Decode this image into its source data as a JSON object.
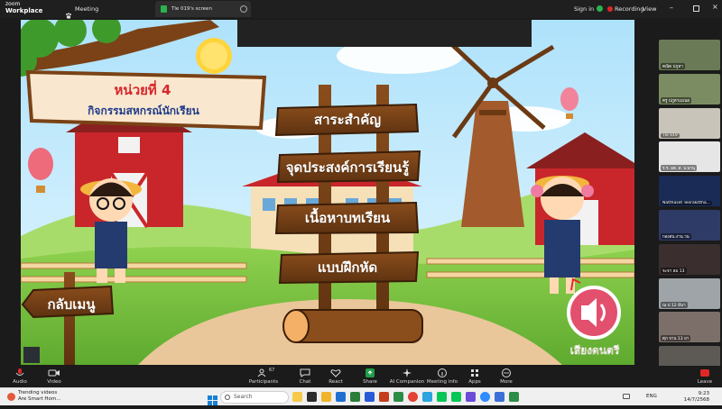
{
  "zoom": {
    "brand_line1": "zoom",
    "brand_line2": "Workplace",
    "meeting_label": "Meeting",
    "tab_label": "Tle 019's screen",
    "sign_in": "Sign in",
    "recording": "Recording",
    "view": "View"
  },
  "game": {
    "unit_title": "หน่วยที่ 4",
    "unit_subtitle": "กิจกรรมสหกรณ์นักเรียน",
    "menu": [
      "สาระสำคัญ",
      "จุดประสงค์การเรียนรู้",
      "เนื้อหาบทเรียน",
      "แบบฝึกหัด"
    ],
    "back_button": "กลับเมนู",
    "music_label": "เสียงดนตรี"
  },
  "participants": [
    {
      "name": "คณิต ปภูหา",
      "color": "#6b7a56"
    },
    {
      "name": "ครู ปภูหาเมเนอ",
      "color": "#7c8c62"
    },
    {
      "name": "Tle 019",
      "color": "#c9c4b9"
    },
    {
      "name": "ร.ร. อด. ส. บ.พานุ",
      "color": "#e6e6e6"
    },
    {
      "name": "Natthaset Teerakittha...",
      "color": "#1a2b55"
    },
    {
      "name": "กองสน.งาน.วน",
      "color": "#2e3b66"
    },
    {
      "name": "จะจา ลม 13",
      "color": "#3a2e2e"
    },
    {
      "name": "ณ ป 12 มีนา",
      "color": "#9fa4a8"
    },
    {
      "name": "ศุภ จาน 13 ยา",
      "color": "#7c6f6a"
    },
    {
      "name": "ศุภ ลน ค 12 ร.อนมา",
      "color": "#5d5a55"
    }
  ],
  "toolbar": {
    "items": [
      "Audio",
      "Video",
      "Participants",
      "Chat",
      "React",
      "Share",
      "AI Companion",
      "Meeting info",
      "Apps",
      "More"
    ],
    "participants_count": "67",
    "leave": "Leave"
  },
  "taskbar": {
    "weather_line1": "Trending videos",
    "weather_line2": "Are Smart Hom...",
    "search_placeholder": "Search",
    "lang": "ENG",
    "time": "9:23",
    "date": "14/7/2568"
  },
  "colors": {
    "zoom_bg": "#1f1f1f",
    "share_green": "#1e9e4a",
    "leave_red": "#e02727",
    "title_red": "#d8262a",
    "title_blue": "#1f3b8a",
    "wood": "#7a4216"
  }
}
